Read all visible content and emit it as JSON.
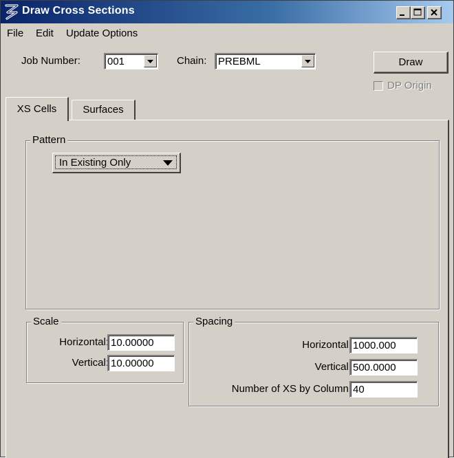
{
  "window": {
    "title": "Draw Cross Sections"
  },
  "titlebar_buttons": [
    "minimize-icon",
    "maximize-icon",
    "close-icon"
  ],
  "menu": [
    "File",
    "Edit",
    "Update Options"
  ],
  "header": {
    "job_number_label": "Job Number:",
    "job_number_value": "001",
    "chain_label": "Chain:",
    "chain_value": "PREBML",
    "draw_label": "Draw",
    "dp_origin_label": "DP Origin",
    "dp_origin_checked": false
  },
  "tabs": [
    {
      "label": "XS Cells",
      "active": true
    },
    {
      "label": "Surfaces",
      "active": false
    }
  ],
  "pattern": {
    "title": "Pattern",
    "selected": "In Existing Only"
  },
  "scale": {
    "title": "Scale",
    "horizontal_label": "Horizontal:",
    "horizontal_value": "10.00000",
    "vertical_label": "Vertical:",
    "vertical_value": "10.00000"
  },
  "spacing": {
    "title": "Spacing",
    "horizontal_label": "Horizontal:",
    "horizontal_value": "1000.000",
    "vertical_label": "Vertical:",
    "vertical_value": "500.0000",
    "columns_label": "Number of XS by Column:",
    "columns_value": "40"
  },
  "colors": {
    "titlebar_start": "#0a246a",
    "titlebar_end": "#a6caf0",
    "face": "#d4d0c8"
  }
}
